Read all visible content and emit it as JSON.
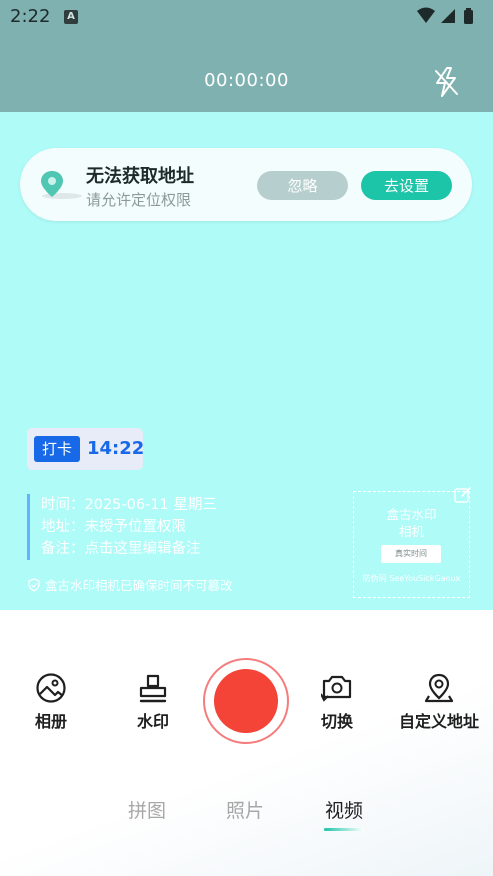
{
  "status_bar": {
    "time": "2:22",
    "notification_glyph": "A",
    "icons": [
      "wifi-icon",
      "cellular-icon",
      "battery-icon"
    ]
  },
  "camera_header": {
    "timer": "00:00:00",
    "flash_icon": "flash-off-icon"
  },
  "location_prompt": {
    "title": "无法获取地址",
    "subtitle": "请允许定位权限",
    "ignore_label": "忽略",
    "settings_label": "去设置"
  },
  "watermark": {
    "clockin_label": "打卡",
    "clockin_time": "14:22",
    "time_line": "时间：2025-06-11 星期三",
    "address_line": "地址：未授予位置权限",
    "note_line": "备注：点击这里编辑备注",
    "notice": "盒古水印相机已确保时间不可篡改",
    "brand_line1": "盒古水印",
    "brand_line2": "相机",
    "brand_chip": "真实时间",
    "brand_foot": "防伪码 SeeYouSickGaoux"
  },
  "toolbar": {
    "album_label": "相册",
    "watermark_label": "水印",
    "switch_label": "切换",
    "custom_address_label": "自定义地址"
  },
  "modes": {
    "items": [
      "拼图",
      "照片",
      "视频"
    ],
    "active": "视频"
  },
  "colors": {
    "header_bg": "#7fb1b1",
    "viewfinder_bg": "#aefbf8",
    "accent_teal": "#1cc4a8",
    "record_red": "#f44337",
    "clockin_blue": "#1769e7"
  }
}
